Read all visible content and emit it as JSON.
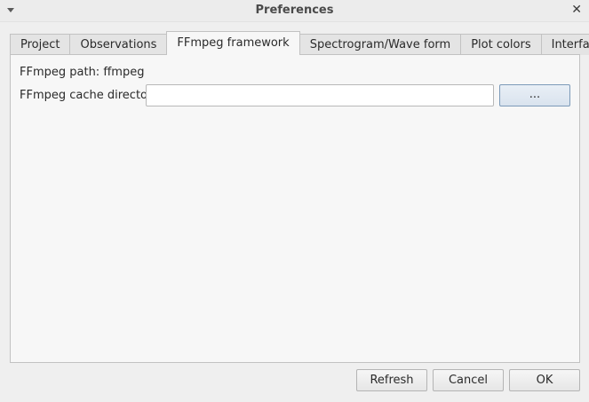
{
  "window": {
    "title": "Preferences",
    "close_glyph": "✕",
    "window_menu_icon": "chevron-down-icon",
    "close_icon": "close-icon"
  },
  "tabs": [
    {
      "label": "Project",
      "active": false
    },
    {
      "label": "Observations",
      "active": false
    },
    {
      "label": "FFmpeg framework",
      "active": true
    },
    {
      "label": "Spectrogram/Wave form",
      "active": false
    },
    {
      "label": "Plot colors",
      "active": false
    },
    {
      "label": "Interface",
      "active": false
    }
  ],
  "ffmpeg": {
    "path_label": "FFmpeg path: ffmpeg",
    "cache_dir_label": "FFmpeg cache directory",
    "cache_dir_value": "",
    "browse_label": "..."
  },
  "footer": {
    "refresh_label": "Refresh",
    "cancel_label": "Cancel",
    "ok_label": "OK"
  },
  "colors": {
    "panel_bg": "#f7f7f7",
    "window_bg": "#efefef",
    "focus_border": "#7c9ab8"
  }
}
